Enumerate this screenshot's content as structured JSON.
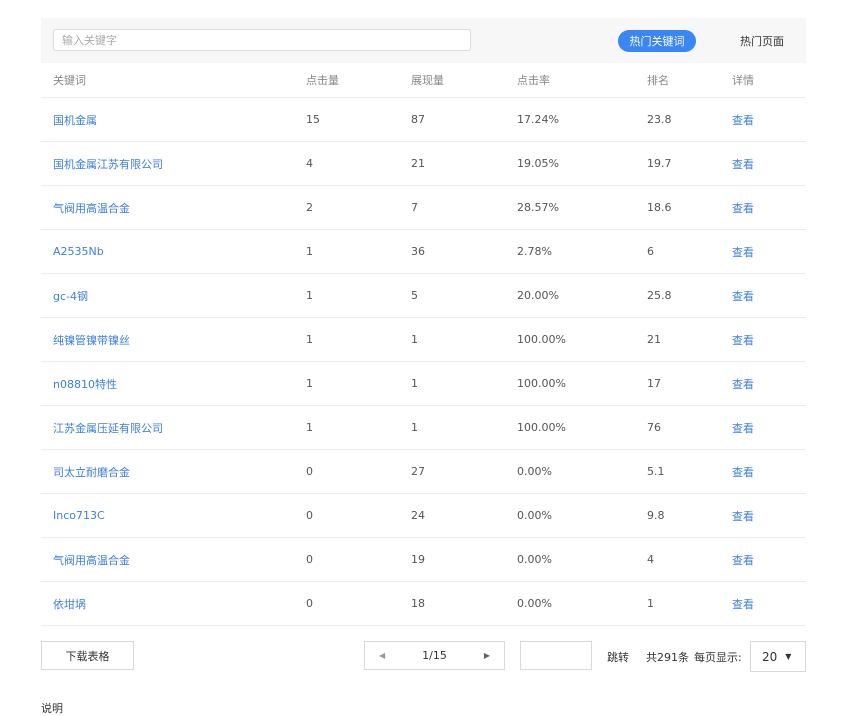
{
  "search": {
    "placeholder": "输入关键字",
    "value": ""
  },
  "tabs": {
    "hot_keywords": "热门关键词",
    "hot_pages": "热门页面",
    "active": "hot_keywords",
    "active_color": "#3b86f5"
  },
  "table": {
    "headers": [
      "关键词",
      "点击量",
      "展现量",
      "点击率",
      "排名",
      "详情"
    ],
    "rows": [
      {
        "keyword": "国机金属",
        "clicks": "15",
        "impressions": "87",
        "ctr": "17.24%",
        "rank": "23.8",
        "detail": "查看"
      },
      {
        "keyword": "国机金属江苏有限公司",
        "clicks": "4",
        "impressions": "21",
        "ctr": "19.05%",
        "rank": "19.7",
        "detail": "查看"
      },
      {
        "keyword": "气阀用高温合金",
        "clicks": "2",
        "impressions": "7",
        "ctr": "28.57%",
        "rank": "18.6",
        "detail": "查看"
      },
      {
        "keyword": "A2535Nb",
        "clicks": "1",
        "impressions": "36",
        "ctr": "2.78%",
        "rank": "6",
        "detail": "查看"
      },
      {
        "keyword": "gc-4钢",
        "clicks": "1",
        "impressions": "5",
        "ctr": "20.00%",
        "rank": "25.8",
        "detail": "查看"
      },
      {
        "keyword": "纯镍管镍带镍丝",
        "clicks": "1",
        "impressions": "1",
        "ctr": "100.00%",
        "rank": "21",
        "detail": "查看"
      },
      {
        "keyword": "n08810特性",
        "clicks": "1",
        "impressions": "1",
        "ctr": "100.00%",
        "rank": "17",
        "detail": "查看"
      },
      {
        "keyword": "江苏金属压延有限公司",
        "clicks": "1",
        "impressions": "1",
        "ctr": "100.00%",
        "rank": "76",
        "detail": "查看"
      },
      {
        "keyword": "司太立耐磨合金",
        "clicks": "0",
        "impressions": "27",
        "ctr": "0.00%",
        "rank": "5.1",
        "detail": "查看"
      },
      {
        "keyword": "Inco713C",
        "clicks": "0",
        "impressions": "24",
        "ctr": "0.00%",
        "rank": "9.8",
        "detail": "查看"
      },
      {
        "keyword": "气阀用高温合金",
        "clicks": "0",
        "impressions": "19",
        "ctr": "0.00%",
        "rank": "4",
        "detail": "查看"
      },
      {
        "keyword": "依坩埚",
        "clicks": "0",
        "impressions": "18",
        "ctr": "0.00%",
        "rank": "1",
        "detail": "查看"
      }
    ]
  },
  "footer": {
    "download_label": "下载表格",
    "page_indicator": "1/15",
    "jump_value": "",
    "jump_label": "跳转",
    "total_label": "共291条",
    "per_page_label": "每页显示:",
    "per_page_value": "20"
  },
  "note": "说明"
}
